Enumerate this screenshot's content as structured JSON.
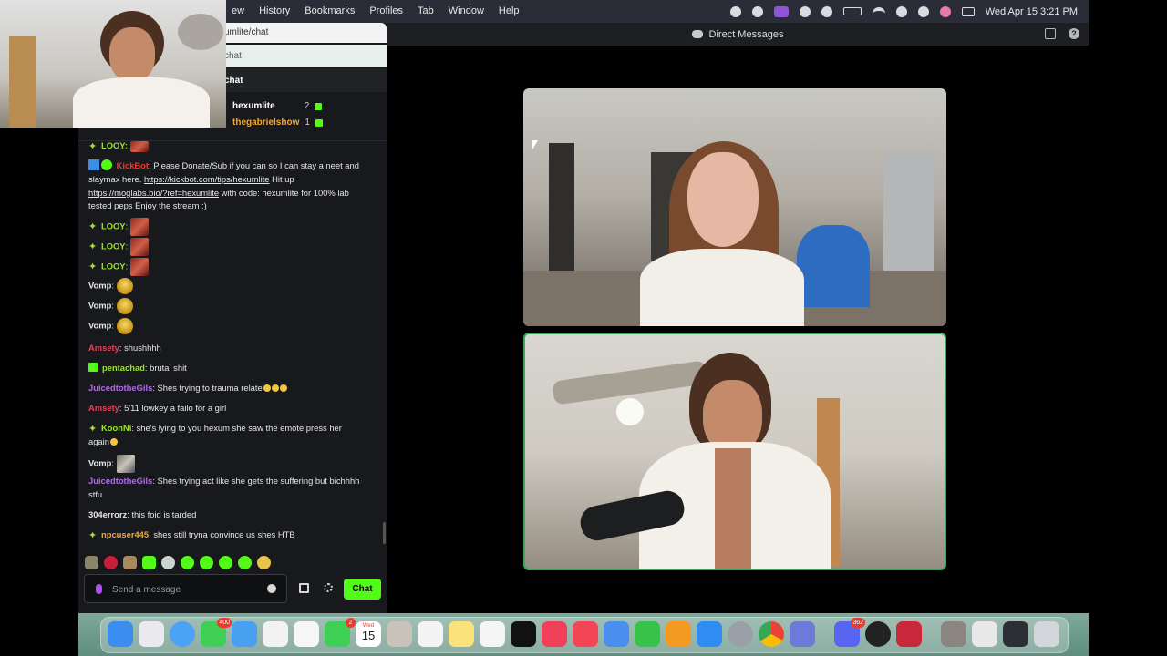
{
  "menubar": {
    "items": [
      "ew",
      "History",
      "Bookmarks",
      "Profiles",
      "Tab",
      "Window",
      "Help"
    ],
    "clock": "Wed Apr 15  3:21 PM"
  },
  "browser": {
    "address": "umlite/chat",
    "search_text": "chat",
    "chat_header": "chat"
  },
  "leaderboard": [
    {
      "name": "hexumlite",
      "count": "2",
      "color": "#ffffff"
    },
    {
      "name": "thegabrielshow",
      "count": "1",
      "color": "#f0a832"
    }
  ],
  "chat": {
    "messages": [
      {
        "id": "kickbot",
        "user": "KickBot",
        "color": "#e63b2e",
        "sep": ": ",
        "text_a": "Please Donate/Sub if you can so I can stay a neet and slaymax here. ",
        "link_a": "https://kickbot.com/tips/hexumlite",
        "text_b": " Hit up ",
        "link_b": "https://moglabs.bio/?ref=hexumlite",
        "text_c": " with code: hexumlite for 100% lab tested peps Enjoy the stream :)"
      },
      {
        "id": "looy1",
        "user": "LOOY",
        "color": "#9ee035",
        "sep": ":"
      },
      {
        "id": "looy2",
        "user": "LOOY",
        "color": "#9ee035",
        "sep": ":"
      },
      {
        "id": "looy3",
        "user": "LOOY",
        "color": "#9ee035",
        "sep": ":"
      },
      {
        "id": "vomp1",
        "user": "Vomp",
        "color": "#e6e6e6",
        "sep": ":"
      },
      {
        "id": "vomp2",
        "user": "Vomp",
        "color": "#e6e6e6",
        "sep": ":"
      },
      {
        "id": "vomp3",
        "user": "Vomp",
        "color": "#e6e6e6",
        "sep": ":"
      },
      {
        "id": "amsety1",
        "user": "Amsety",
        "color": "#e64058",
        "sep": ": ",
        "text": "shushhhh"
      },
      {
        "id": "pentachad",
        "user": "pentachad",
        "color": "#9ee035",
        "sep": ": ",
        "text": "brutal shit"
      },
      {
        "id": "juiced1",
        "user": "JuicedtotheGils",
        "color": "#b06ae8",
        "sep": ": ",
        "text": "Shes trying to trauma relate"
      },
      {
        "id": "amsety2",
        "user": "Amsety",
        "color": "#e64058",
        "sep": ": ",
        "text": "5'11 lowkey a failo for a girl"
      },
      {
        "id": "koonni",
        "user": "KoonNi",
        "color": "#9ee035",
        "sep": ": ",
        "text": "she's lying to you hexum she saw the emote press her again"
      },
      {
        "id": "vomp4",
        "user": "Vomp",
        "color": "#e6e6e6",
        "sep": ":"
      },
      {
        "id": "juiced2",
        "user": "JuicedtotheGils",
        "color": "#b06ae8",
        "sep": ": ",
        "text": "Shes trying act like she gets the suffering but bichhhh stfu"
      },
      {
        "id": "error",
        "user": "304errorz",
        "color": "#e6e6e6",
        "sep": ": ",
        "text": "this foid is tarded"
      },
      {
        "id": "npc",
        "user": "npcuser445",
        "color": "#f0a832",
        "sep": ": ",
        "text": "shes still tryna convince us shes HTB"
      }
    ],
    "partial_top": "LOOY:",
    "input_placeholder": "Send a message",
    "send_label": "Chat"
  },
  "discord": {
    "title": "Direct Messages"
  },
  "dock": {
    "messages_badge": "400",
    "facetime_badge": "2",
    "discord_badge": "362",
    "calendar_month": "Wed",
    "calendar_day": "15"
  }
}
